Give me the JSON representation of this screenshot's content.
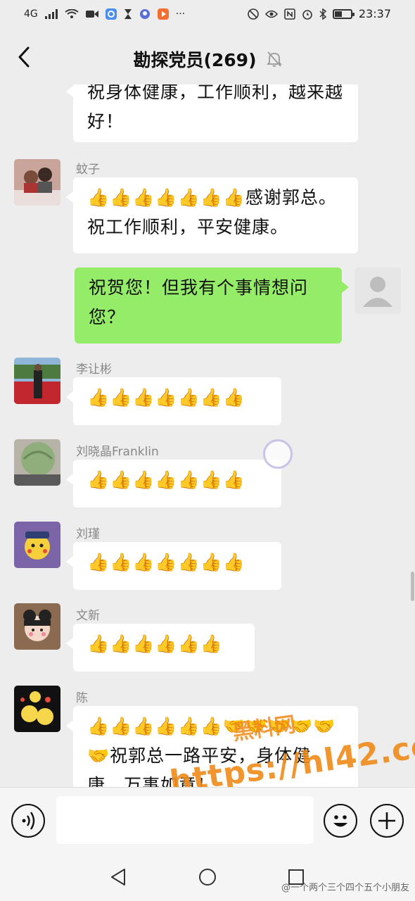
{
  "status_bar": {
    "network": "4G",
    "time": "23:37",
    "battery_level": 0.45
  },
  "header": {
    "title": "勘探党员(269)"
  },
  "messages": [
    {
      "type": "other",
      "sender": "",
      "text": "祝身体健康，工作顺利，越来越好！"
    },
    {
      "type": "other",
      "sender": "蚊子",
      "text": "👍👍👍👍👍👍👍感谢郭总。祝工作顺利，平安健康。"
    },
    {
      "type": "mine",
      "text": "祝贺您！但我有个事情想问您？"
    },
    {
      "type": "other",
      "sender": "李让彬",
      "text": "👍👍👍👍👍👍👍"
    },
    {
      "type": "other",
      "sender": "刘晓晶Franklin",
      "text": "👍👍👍👍👍👍👍"
    },
    {
      "type": "other",
      "sender": "刘瑾",
      "text": "👍👍👍👍👍👍👍"
    },
    {
      "type": "other",
      "sender": "文新",
      "text": "👍👍👍👍👍👍"
    },
    {
      "type": "other",
      "sender": "陈",
      "text": "👍👍👍👍👍👍🤝🤝🤝🤝🤝🤝祝郭总一路平安，身体健康，万事如意！"
    }
  ],
  "watermark": {
    "cn": "黑料网",
    "url": "https://hl42.co",
    "weibo": "@一个两个三个四个五个小朋友"
  }
}
